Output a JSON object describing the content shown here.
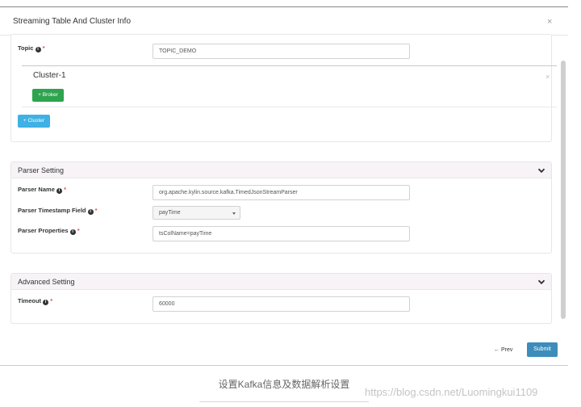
{
  "modal": {
    "title": "Streaming Table And Cluster Info",
    "close_glyph": "×"
  },
  "topic": {
    "label": "Topic",
    "info_glyph": "i",
    "required_mark": "*",
    "value": "TOPIC_DEMO"
  },
  "cluster": {
    "title": "Cluster-1",
    "close_glyph": "×",
    "add_broker_label": "+ Broker",
    "add_cluster_label": "+ Cluster"
  },
  "parser": {
    "title": "Parser Setting",
    "name_label": "Parser Name",
    "name_value": "org.apache.kylin.source.kafka.TimedJsonStreamParser",
    "timestamp_label": "Parser Timestamp Field",
    "timestamp_value": "payTime",
    "properties_label": "Parser Properties",
    "properties_value": "tsColName=payTime",
    "info_glyph": "i",
    "required_mark": "*"
  },
  "advanced": {
    "title": "Advanced Setting",
    "timeout_label": "Timeout",
    "timeout_value": "60000",
    "info_glyph": "i",
    "required_mark": "*"
  },
  "footer": {
    "prev_label": "Prev",
    "prev_glyph": "←",
    "submit_label": "Submit"
  },
  "caption": "设置Kafka信息及数据解析设置",
  "watermark": "https://blog.csdn.net/Luomingkui1109",
  "colors": {
    "broker_button": "#2ea44f",
    "cluster_button": "#3fb1e3",
    "submit_button": "#3c8dbc",
    "required": "#d9534f"
  }
}
